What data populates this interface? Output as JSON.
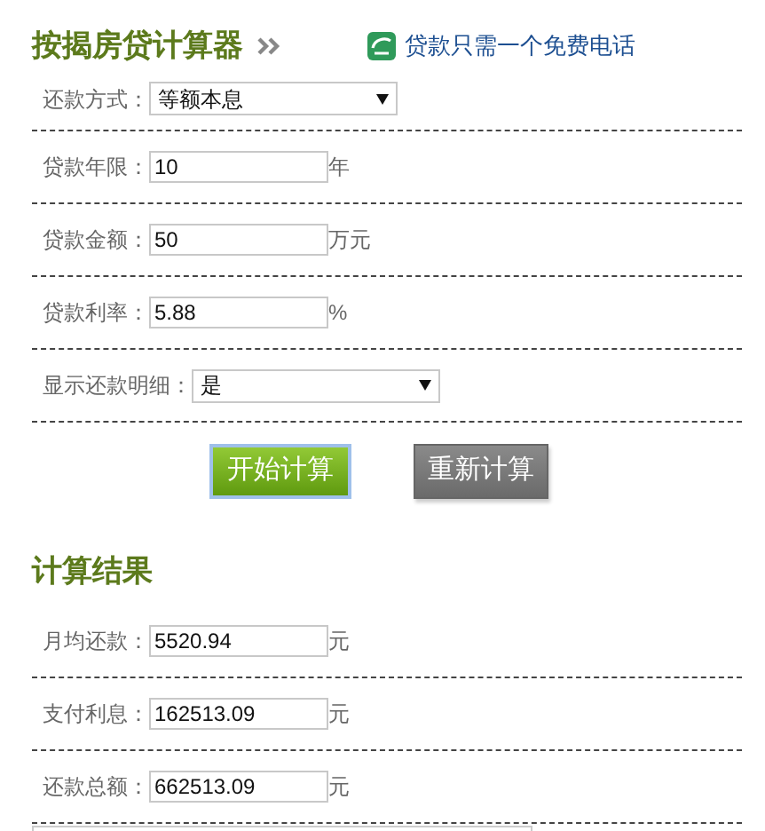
{
  "title": "按揭房贷计算器",
  "promo_link": "贷款只需一个免费电话",
  "form": [
    {
      "kind": "select",
      "label": "还款方式：",
      "value": "等额本息"
    },
    {
      "kind": "input",
      "label": "贷款年限：",
      "value": "10",
      "unit": "年"
    },
    {
      "kind": "input",
      "label": "贷款金额：",
      "value": "50",
      "unit": "万元"
    },
    {
      "kind": "input",
      "label": "贷款利率：",
      "value": "5.88",
      "unit": "%"
    },
    {
      "kind": "select",
      "label": "显示还款明细：",
      "value": "是"
    }
  ],
  "buttons": [
    {
      "label": "开始计算",
      "kind": "primary",
      "focused": true
    },
    {
      "label": "重新计算",
      "kind": "secondary",
      "focused": false
    }
  ],
  "results_title": "计算结果",
  "results": [
    {
      "label": "月均还款：",
      "value": "5520.94",
      "unit": "元"
    },
    {
      "label": "支付利息：",
      "value": "162513.09",
      "unit": "元"
    },
    {
      "label": "还款总额：",
      "value": "662513.09",
      "unit": "元"
    }
  ]
}
